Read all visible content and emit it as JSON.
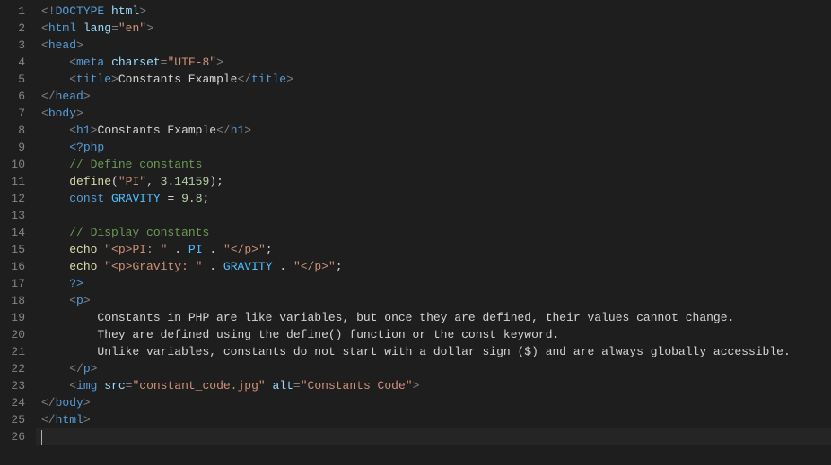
{
  "editor": {
    "language": "php-html",
    "lineCount": 26,
    "cursorLine": 26,
    "lineNumbers": [
      "1",
      "2",
      "3",
      "4",
      "5",
      "6",
      "7",
      "8",
      "9",
      "10",
      "11",
      "12",
      "13",
      "14",
      "15",
      "16",
      "17",
      "18",
      "19",
      "20",
      "21",
      "22",
      "23",
      "24",
      "25",
      "26"
    ]
  },
  "code": {
    "lines": [
      {
        "n": 1,
        "tokens": [
          {
            "c": "t-punc",
            "t": "<!"
          },
          {
            "c": "t-doctype",
            "t": "DOCTYPE"
          },
          {
            "c": "t-text",
            "t": " "
          },
          {
            "c": "t-attr",
            "t": "html"
          },
          {
            "c": "t-punc",
            "t": ">"
          }
        ]
      },
      {
        "n": 2,
        "tokens": [
          {
            "c": "t-punc",
            "t": "<"
          },
          {
            "c": "t-tag",
            "t": "html"
          },
          {
            "c": "t-text",
            "t": " "
          },
          {
            "c": "t-attr",
            "t": "lang"
          },
          {
            "c": "t-punc",
            "t": "="
          },
          {
            "c": "t-str",
            "t": "\"en\""
          },
          {
            "c": "t-punc",
            "t": ">"
          }
        ]
      },
      {
        "n": 3,
        "tokens": [
          {
            "c": "t-punc",
            "t": "<"
          },
          {
            "c": "t-tag",
            "t": "head"
          },
          {
            "c": "t-punc",
            "t": ">"
          }
        ]
      },
      {
        "n": 4,
        "indent": 1,
        "tokens": [
          {
            "c": "t-punc",
            "t": "<"
          },
          {
            "c": "t-tag",
            "t": "meta"
          },
          {
            "c": "t-text",
            "t": " "
          },
          {
            "c": "t-attr",
            "t": "charset"
          },
          {
            "c": "t-punc",
            "t": "="
          },
          {
            "c": "t-str",
            "t": "\"UTF-8\""
          },
          {
            "c": "t-punc",
            "t": ">"
          }
        ]
      },
      {
        "n": 5,
        "indent": 1,
        "tokens": [
          {
            "c": "t-punc",
            "t": "<"
          },
          {
            "c": "t-tag",
            "t": "title"
          },
          {
            "c": "t-punc",
            "t": ">"
          },
          {
            "c": "t-text",
            "t": "Constants Example"
          },
          {
            "c": "t-punc",
            "t": "</"
          },
          {
            "c": "t-tag",
            "t": "title"
          },
          {
            "c": "t-punc",
            "t": ">"
          }
        ]
      },
      {
        "n": 6,
        "tokens": [
          {
            "c": "t-punc",
            "t": "</"
          },
          {
            "c": "t-tag",
            "t": "head"
          },
          {
            "c": "t-punc",
            "t": ">"
          }
        ]
      },
      {
        "n": 7,
        "tokens": [
          {
            "c": "t-punc",
            "t": "<"
          },
          {
            "c": "t-tag",
            "t": "body"
          },
          {
            "c": "t-punc",
            "t": ">"
          }
        ]
      },
      {
        "n": 8,
        "indent": 1,
        "tokens": [
          {
            "c": "t-punc",
            "t": "<"
          },
          {
            "c": "t-tag",
            "t": "h1"
          },
          {
            "c": "t-punc",
            "t": ">"
          },
          {
            "c": "t-text",
            "t": "Constants Example"
          },
          {
            "c": "t-punc",
            "t": "</"
          },
          {
            "c": "t-tag",
            "t": "h1"
          },
          {
            "c": "t-punc",
            "t": ">"
          }
        ]
      },
      {
        "n": 9,
        "indent": 1,
        "tokens": [
          {
            "c": "t-php",
            "t": "<?php"
          }
        ]
      },
      {
        "n": 10,
        "indent": 1,
        "tokens": [
          {
            "c": "t-comment",
            "t": "// Define constants"
          }
        ]
      },
      {
        "n": 11,
        "indent": 1,
        "tokens": [
          {
            "c": "t-func",
            "t": "define"
          },
          {
            "c": "t-op",
            "t": "("
          },
          {
            "c": "t-str",
            "t": "\"PI\""
          },
          {
            "c": "t-op",
            "t": ", "
          },
          {
            "c": "t-num",
            "t": "3.14159"
          },
          {
            "c": "t-op",
            "t": ")"
          },
          {
            "c": "t-semi",
            "t": ";"
          }
        ]
      },
      {
        "n": 12,
        "indent": 1,
        "tokens": [
          {
            "c": "t-keyword",
            "t": "const"
          },
          {
            "c": "t-text",
            "t": " "
          },
          {
            "c": "t-const",
            "t": "GRAVITY"
          },
          {
            "c": "t-text",
            "t": " "
          },
          {
            "c": "t-op",
            "t": "="
          },
          {
            "c": "t-text",
            "t": " "
          },
          {
            "c": "t-num",
            "t": "9.8"
          },
          {
            "c": "t-semi",
            "t": ";"
          }
        ]
      },
      {
        "n": 13,
        "indent": 0,
        "tokens": []
      },
      {
        "n": 14,
        "indent": 1,
        "tokens": [
          {
            "c": "t-comment",
            "t": "// Display constants"
          }
        ]
      },
      {
        "n": 15,
        "indent": 1,
        "tokens": [
          {
            "c": "t-func",
            "t": "echo"
          },
          {
            "c": "t-text",
            "t": " "
          },
          {
            "c": "t-str",
            "t": "\"<p>PI: \""
          },
          {
            "c": "t-text",
            "t": " "
          },
          {
            "c": "t-op",
            "t": "."
          },
          {
            "c": "t-text",
            "t": " "
          },
          {
            "c": "t-const",
            "t": "PI"
          },
          {
            "c": "t-text",
            "t": " "
          },
          {
            "c": "t-op",
            "t": "."
          },
          {
            "c": "t-text",
            "t": " "
          },
          {
            "c": "t-str",
            "t": "\"</p>\""
          },
          {
            "c": "t-semi",
            "t": ";"
          }
        ]
      },
      {
        "n": 16,
        "indent": 1,
        "tokens": [
          {
            "c": "t-func",
            "t": "echo"
          },
          {
            "c": "t-text",
            "t": " "
          },
          {
            "c": "t-str",
            "t": "\"<p>Gravity: \""
          },
          {
            "c": "t-text",
            "t": " "
          },
          {
            "c": "t-op",
            "t": "."
          },
          {
            "c": "t-text",
            "t": " "
          },
          {
            "c": "t-const",
            "t": "GRAVITY"
          },
          {
            "c": "t-text",
            "t": " "
          },
          {
            "c": "t-op",
            "t": "."
          },
          {
            "c": "t-text",
            "t": " "
          },
          {
            "c": "t-str",
            "t": "\"</p>\""
          },
          {
            "c": "t-semi",
            "t": ";"
          }
        ]
      },
      {
        "n": 17,
        "indent": 1,
        "tokens": [
          {
            "c": "t-php",
            "t": "?>"
          }
        ]
      },
      {
        "n": 18,
        "indent": 1,
        "tokens": [
          {
            "c": "t-punc",
            "t": "<"
          },
          {
            "c": "t-tag",
            "t": "p"
          },
          {
            "c": "t-punc",
            "t": ">"
          }
        ]
      },
      {
        "n": 19,
        "indent": 2,
        "tokens": [
          {
            "c": "t-text",
            "t": "Constants in PHP are like variables, but once they are defined, their values cannot change."
          }
        ]
      },
      {
        "n": 20,
        "indent": 2,
        "tokens": [
          {
            "c": "t-text",
            "t": "They are defined using the define() function or the const keyword."
          }
        ]
      },
      {
        "n": 21,
        "indent": 2,
        "tokens": [
          {
            "c": "t-text",
            "t": "Unlike variables, constants do not start with a dollar sign ($) and are always globally accessible."
          }
        ]
      },
      {
        "n": 22,
        "indent": 1,
        "tokens": [
          {
            "c": "t-punc",
            "t": "</"
          },
          {
            "c": "t-tag",
            "t": "p"
          },
          {
            "c": "t-punc",
            "t": ">"
          }
        ]
      },
      {
        "n": 23,
        "indent": 1,
        "tokens": [
          {
            "c": "t-punc",
            "t": "<"
          },
          {
            "c": "t-tag",
            "t": "img"
          },
          {
            "c": "t-text",
            "t": " "
          },
          {
            "c": "t-attr",
            "t": "src"
          },
          {
            "c": "t-punc",
            "t": "="
          },
          {
            "c": "t-str",
            "t": "\"constant_code.jpg\""
          },
          {
            "c": "t-text",
            "t": " "
          },
          {
            "c": "t-attr",
            "t": "alt"
          },
          {
            "c": "t-punc",
            "t": "="
          },
          {
            "c": "t-str",
            "t": "\"Constants Code\""
          },
          {
            "c": "t-punc",
            "t": ">"
          }
        ]
      },
      {
        "n": 24,
        "tokens": [
          {
            "c": "t-punc",
            "t": "</"
          },
          {
            "c": "t-tag",
            "t": "body"
          },
          {
            "c": "t-punc",
            "t": ">"
          }
        ]
      },
      {
        "n": 25,
        "tokens": [
          {
            "c": "t-punc",
            "t": "</"
          },
          {
            "c": "t-tag",
            "t": "html"
          },
          {
            "c": "t-punc",
            "t": ">"
          }
        ]
      },
      {
        "n": 26,
        "tokens": []
      }
    ]
  }
}
